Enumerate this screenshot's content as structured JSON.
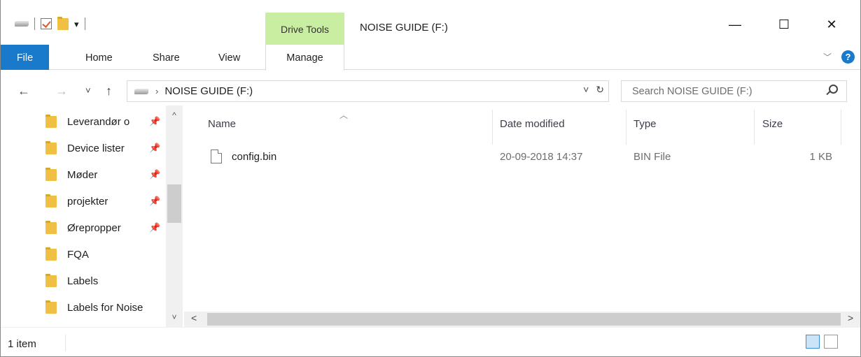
{
  "window": {
    "title": "NOISE GUIDE (F:)",
    "contextual_tab": "Drive Tools",
    "controls": {
      "minimize": "—",
      "maximize": "☐",
      "close": "✕"
    }
  },
  "ribbon": {
    "tabs": [
      "File",
      "Home",
      "Share",
      "View",
      "Manage"
    ]
  },
  "nav": {
    "back": "←",
    "forward": "→",
    "recent": "˅",
    "up": "↑",
    "breadcrumb": "NOISE GUIDE (F:)",
    "search_placeholder": "Search NOISE GUIDE (F:)"
  },
  "sidebar": {
    "items": [
      {
        "label": "Leverandør o",
        "pinned": true
      },
      {
        "label": "Device lister",
        "pinned": true
      },
      {
        "label": "Møder",
        "pinned": true
      },
      {
        "label": "projekter",
        "pinned": true
      },
      {
        "label": "Ørepropper",
        "pinned": true
      },
      {
        "label": "FQA",
        "pinned": false
      },
      {
        "label": "Labels",
        "pinned": false
      },
      {
        "label": "Labels for Noise",
        "pinned": false
      }
    ]
  },
  "file_list": {
    "columns": [
      "Name",
      "Date modified",
      "Type",
      "Size"
    ],
    "rows": [
      {
        "name": "config.bin",
        "date_modified": "20-09-2018 14:37",
        "type": "BIN File",
        "size": "1 KB"
      }
    ]
  },
  "status": {
    "item_count": "1 item"
  },
  "colors": {
    "accent": "#1979ca",
    "drive_tools": "#c9eea1",
    "folder": "#f0c044"
  }
}
